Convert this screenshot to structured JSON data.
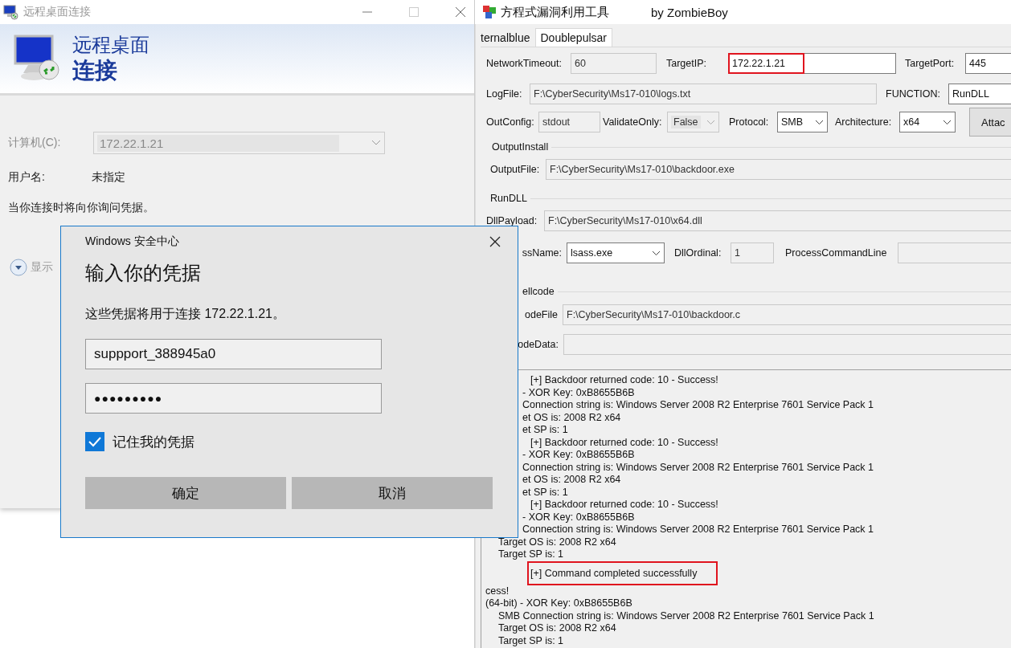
{
  "rdp_window": {
    "title": "远程桌面连接",
    "banner": {
      "line1": "远程桌面",
      "line2": "连接"
    },
    "computer": {
      "label": "计算机(C):",
      "value": "172.22.1.21",
      "disabled": true
    },
    "username": {
      "label": "用户名:",
      "value": "未指定"
    },
    "note": "当你连接时将向你询问凭据。",
    "options_toggle": "显示"
  },
  "tool_window": {
    "title": "方程式漏洞利用工具",
    "author": "by ZombieBoy",
    "tabs": [
      {
        "label": "ternalblue",
        "selected": false
      },
      {
        "label": "Doublepulsar",
        "selected": true
      }
    ],
    "rows": [
      {
        "kind": "fields",
        "items": [
          {
            "label": "NetworkTimeout:",
            "kind": "text",
            "value": "60",
            "disabled": true
          },
          {
            "label": "TargetIP:",
            "kind": "text",
            "value": "172.22.1.21",
            "disabled": false,
            "highlighted": true
          },
          {
            "label": "TargetPort:",
            "kind": "text",
            "value": "445",
            "disabled": false
          }
        ]
      },
      {
        "kind": "fields",
        "items": [
          {
            "label": "LogFile:",
            "kind": "text",
            "value": "F:\\CyberSecurity\\Ms17-010\\logs.txt",
            "disabled": true
          },
          {
            "label": "FUNCTION:",
            "kind": "text",
            "value": "RunDLL",
            "disabled": false
          }
        ]
      },
      {
        "kind": "fields",
        "items": [
          {
            "label": "OutConfig:",
            "kind": "text",
            "value": "stdout",
            "disabled": true
          },
          {
            "label": "ValidateOnly:",
            "kind": "combo",
            "value": "False",
            "disabled": true
          },
          {
            "label": "Protocol:",
            "kind": "combo",
            "value": "SMB",
            "disabled": false
          },
          {
            "label": "Architecture:",
            "kind": "combo",
            "value": "x64",
            "disabled": false
          },
          {
            "label": "Attac",
            "kind": "button",
            "disabled": false
          }
        ]
      },
      {
        "kind": "group",
        "title": "OutputInstall"
      },
      {
        "kind": "fields",
        "items": [
          {
            "label": "OutputFile:",
            "kind": "text",
            "value": "F:\\CyberSecurity\\Ms17-010\\backdoor.exe",
            "disabled": true
          }
        ]
      },
      {
        "kind": "group",
        "title": "RunDLL"
      },
      {
        "kind": "fields",
        "items": [
          {
            "label": "DllPayload:",
            "kind": "text",
            "value": "F:\\CyberSecurity\\Ms17-010\\x64.dll",
            "disabled": true
          }
        ]
      },
      {
        "kind": "fields",
        "items": [
          {
            "label": "ssName:",
            "kind": "combo",
            "value": "lsass.exe",
            "disabled": false
          },
          {
            "label": "DllOrdinal:",
            "kind": "text",
            "value": "1",
            "disabled": true
          },
          {
            "label": "ProcessCommandLine",
            "kind": "text",
            "disabled": true
          }
        ]
      },
      {
        "kind": "group",
        "title": "ellcode"
      },
      {
        "kind": "fields",
        "items": [
          {
            "label": "odeFile",
            "kind": "text",
            "value": "F:\\CyberSecurity\\Ms17-010\\backdoor.c",
            "disabled": true
          }
        ]
      },
      {
        "kind": "fields",
        "items": [
          {
            "label": "odeData:",
            "kind": "text",
            "disabled": true
          }
        ]
      }
    ],
    "log": [
      {
        "kind": "step",
        "text": "[+] Backdoor returned code: 10 - Success!",
        "highlighted": false
      },
      {
        "kind": "cut",
        "text": "- XOR Key: 0xB8655B6B",
        "highlighted": false
      },
      {
        "kind": "cut",
        "text": "Connection string is: Windows Server 2008 R2 Enterprise 7601 Service Pack 1",
        "highlighted": false
      },
      {
        "kind": "cut",
        "text": "et OS is: 2008 R2 x64",
        "highlighted": false
      },
      {
        "kind": "cut",
        "text": "et SP is: 1",
        "highlighted": false
      },
      {
        "kind": "step",
        "text": "[+] Backdoor returned code: 10 - Success!",
        "highlighted": false
      },
      {
        "kind": "cut",
        "text": "- XOR Key: 0xB8655B6B",
        "highlighted": false
      },
      {
        "kind": "cut",
        "text": "Connection string is: Windows Server 2008 R2 Enterprise 7601 Service Pack 1",
        "highlighted": false
      },
      {
        "kind": "cut",
        "text": "et OS is: 2008 R2 x64",
        "highlighted": false
      },
      {
        "kind": "cut",
        "text": "et SP is: 1",
        "highlighted": false
      },
      {
        "kind": "step",
        "text": "[+] Backdoor returned code: 10 - Success!",
        "highlighted": false
      },
      {
        "kind": "cut",
        "text": "- XOR Key: 0xB8655B6B",
        "highlighted": false
      },
      {
        "kind": "cut",
        "text": "Connection string is: Windows Server 2008 R2 Enterprise 7601 Service Pack 1",
        "highlighted": false
      },
      {
        "kind": "detail",
        "text": "Target OS is: 2008 R2 x64",
        "highlighted": false
      },
      {
        "kind": "detail",
        "text": "Target SP is: 1",
        "highlighted": false
      },
      {
        "kind": "step",
        "text": "[+] Command completed successfully",
        "highlighted": true
      },
      {
        "kind": "head",
        "text": "cess!",
        "highlighted": false
      },
      {
        "kind": "head",
        "text": "(64-bit) - XOR Key: 0xB8655B6B",
        "highlighted": false
      },
      {
        "kind": "detail",
        "text": "SMB Connection string is: Windows Server 2008 R2 Enterprise 7601 Service Pack 1",
        "highlighted": false
      },
      {
        "kind": "detail",
        "text": "Target OS is: 2008 R2 x64",
        "highlighted": false
      },
      {
        "kind": "detail",
        "text": "Target SP is: 1",
        "highlighted": false
      }
    ]
  },
  "security_dialog": {
    "app": "Windows 安全中心",
    "heading": "输入你的凭据",
    "message": "这些凭据将用于连接 172.22.1.21。",
    "username": {
      "value": "suppport_388945a0"
    },
    "password": {
      "value": "●●●●●●●●●"
    },
    "remember": {
      "label": "记住我的凭据",
      "checked": true
    },
    "buttons": [
      "确定",
      "取消"
    ]
  }
}
